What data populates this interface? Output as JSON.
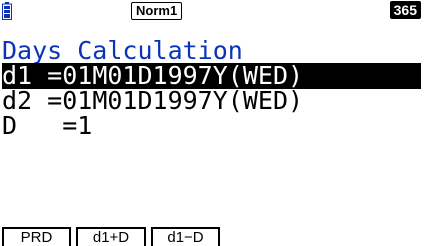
{
  "status_bar": {
    "battery_icon": "battery-icon",
    "mode_badge": "Norm1",
    "counter": "365"
  },
  "screen": {
    "title": "Days Calculation",
    "rows": [
      {
        "label": "d1",
        "value": "=01M01D1997Y(WED)",
        "selected": true
      },
      {
        "label": "d2",
        "value": "=01M01D1997Y(WED)",
        "selected": false
      },
      {
        "label": "D",
        "value": "=1",
        "selected": false
      }
    ]
  },
  "function_keys": [
    {
      "label": "PRD"
    },
    {
      "label": "d1+D"
    },
    {
      "label": "d1−D"
    }
  ],
  "colors": {
    "title": "#0a33b8",
    "selection_bg": "#000000",
    "selection_fg": "#ffffff"
  }
}
